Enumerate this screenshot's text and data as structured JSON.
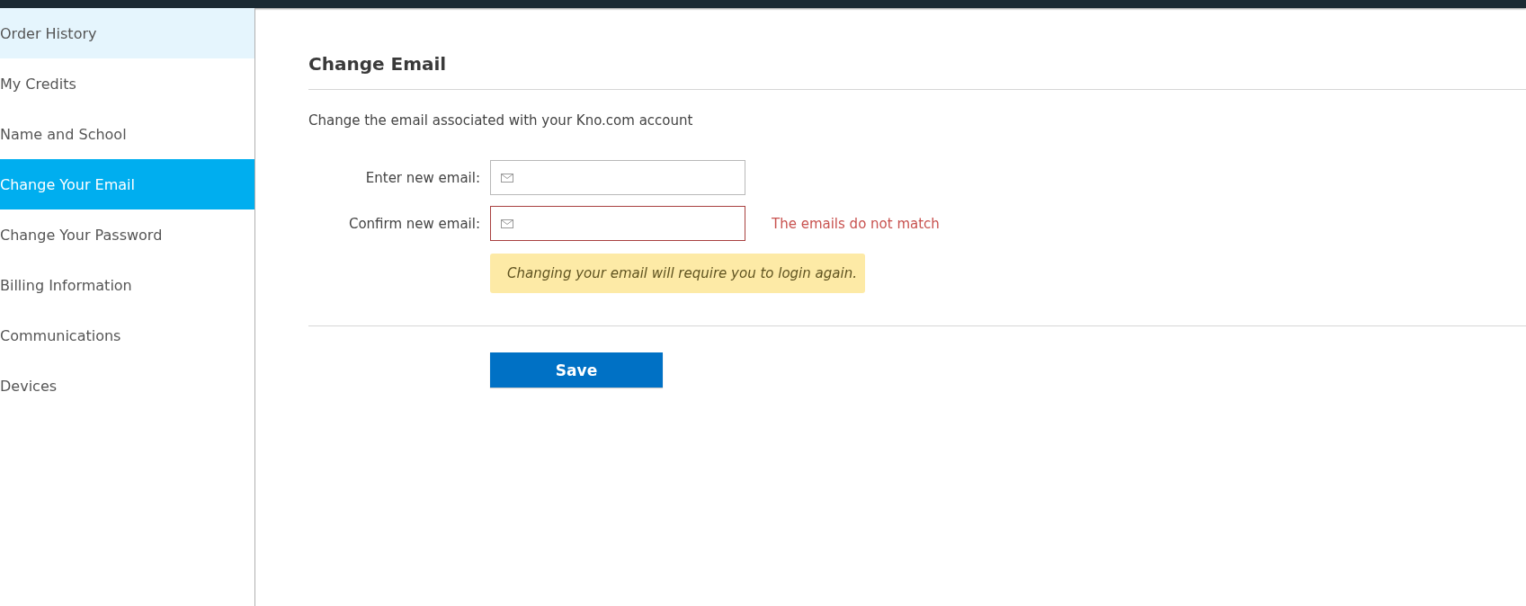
{
  "sidebar": {
    "items": [
      {
        "label": "Order History",
        "selected": false,
        "hovered": true
      },
      {
        "label": "My Credits",
        "selected": false,
        "hovered": false
      },
      {
        "label": "Name and School",
        "selected": false,
        "hovered": false
      },
      {
        "label": "Change Your Email",
        "selected": true,
        "hovered": false
      },
      {
        "label": "Change Your Password",
        "selected": false,
        "hovered": false
      },
      {
        "label": "Billing Information",
        "selected": false,
        "hovered": false
      },
      {
        "label": "Communications",
        "selected": false,
        "hovered": false
      },
      {
        "label": "Devices",
        "selected": false,
        "hovered": false
      }
    ]
  },
  "page": {
    "title": "Change Email",
    "description": "Change the email associated with your Kno.com account",
    "fields": [
      {
        "label": "Enter new email:",
        "invalid": false
      },
      {
        "label": "Confirm new email:",
        "invalid": true,
        "error": "The emails do not match"
      }
    ],
    "notice": "Changing your email will require you to login again.",
    "save_button": "Save"
  }
}
